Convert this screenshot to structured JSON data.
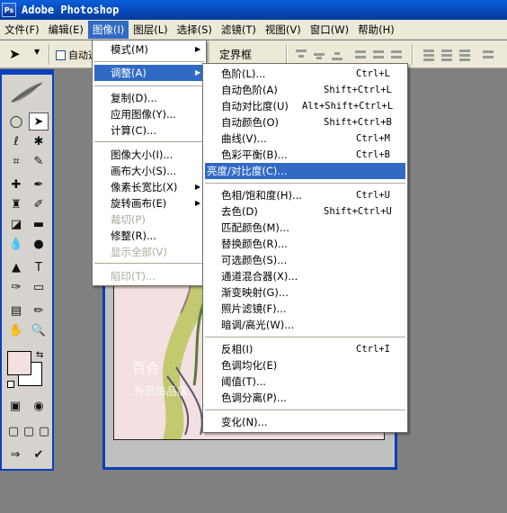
{
  "app": {
    "title": "Adobe Photoshop",
    "icon": "ps-logo-icon"
  },
  "menubar": {
    "items": [
      "文件(F)",
      "编辑(E)",
      "图像(I)",
      "图层(L)",
      "选择(S)",
      "滤镜(T)",
      "视图(V)",
      "窗口(W)",
      "帮助(H)"
    ],
    "active_index": 2
  },
  "options_bar": {
    "auto_select_label": "自动选",
    "show_bounds_label": "定界框",
    "auto_select_checked": false
  },
  "image_menu": {
    "items": [
      {
        "label": "模式(M)",
        "submenu": true,
        "disabled": false
      },
      {
        "label": "调整(A)",
        "submenu": true,
        "disabled": false,
        "highlighted": true
      },
      {
        "label": "复制(D)...",
        "disabled": false
      },
      {
        "label": "应用图像(Y)...",
        "disabled": false
      },
      {
        "label": "计算(C)...",
        "disabled": false
      },
      {
        "label": "图像大小(I)...",
        "disabled": false
      },
      {
        "label": "画布大小(S)...",
        "disabled": false
      },
      {
        "label": "像素长宽比(X)",
        "submenu": true,
        "disabled": false
      },
      {
        "label": "旋转画布(E)",
        "submenu": true,
        "disabled": false
      },
      {
        "label": "裁切(P)",
        "disabled": true
      },
      {
        "label": "修整(R)...",
        "disabled": false
      },
      {
        "label": "显示全部(V)",
        "disabled": true
      },
      {
        "label": "陷印(T)...",
        "disabled": true
      }
    ]
  },
  "adjust_menu": {
    "items": [
      {
        "label": "色阶(L)...",
        "shortcut": "Ctrl+L"
      },
      {
        "label": "自动色阶(A)",
        "shortcut": "Shift+Ctrl+L"
      },
      {
        "label": "自动对比度(U)",
        "shortcut": "Alt+Shift+Ctrl+L"
      },
      {
        "label": "自动颜色(O)",
        "shortcut": "Shift+Ctrl+B"
      },
      {
        "label": "曲线(V)...",
        "shortcut": "Ctrl+M"
      },
      {
        "label": "色彩平衡(B)...",
        "shortcut": "Ctrl+B"
      },
      {
        "label": "亮度/对比度(C)...",
        "shortcut": "",
        "highlighted": true
      },
      {
        "label": "色相/饱和度(H)...",
        "shortcut": "Ctrl+U"
      },
      {
        "label": "去色(D)",
        "shortcut": "Shift+Ctrl+U"
      },
      {
        "label": "匹配颜色(M)...",
        "shortcut": ""
      },
      {
        "label": "替换颜色(R)...",
        "shortcut": ""
      },
      {
        "label": "可选颜色(S)...",
        "shortcut": ""
      },
      {
        "label": "通道混合器(X)...",
        "shortcut": ""
      },
      {
        "label": "渐变映射(G)...",
        "shortcut": ""
      },
      {
        "label": "照片滤镜(F)...",
        "shortcut": ""
      },
      {
        "label": "暗调/高光(W)...",
        "shortcut": ""
      },
      {
        "label": "反相(I)",
        "shortcut": "Ctrl+I"
      },
      {
        "label": "色调均化(E)",
        "shortcut": ""
      },
      {
        "label": "阈值(T)...",
        "shortcut": ""
      },
      {
        "label": "色调分离(P)...",
        "shortcut": ""
      },
      {
        "label": "变化(N)...",
        "shortcut": ""
      }
    ]
  },
  "canvas": {
    "watermark_line1": "百合",
    "watermark_line2": "外贸饰品店"
  },
  "colors": {
    "highlight": "#316ac5",
    "menu_bg": "#ffffff",
    "titlebar": "#0a5fd8",
    "foreground_swatch": "#f3e0e0",
    "background_swatch": "#ffffff"
  }
}
